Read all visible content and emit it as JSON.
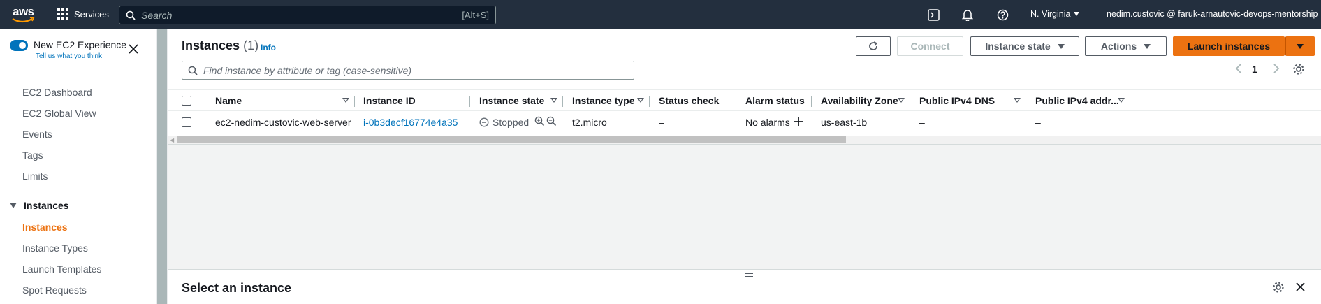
{
  "topnav": {
    "logo": "aws",
    "services_label": "Services",
    "search_placeholder": "Search",
    "search_shortcut": "[Alt+S]",
    "icons": [
      "cloudshell-icon",
      "bell-icon",
      "help-icon"
    ],
    "region": "N. Virginia",
    "account": "nedim.custovic @ faruk-arnautovic-devops-mentorship"
  },
  "sidebar": {
    "toggle_title": "New EC2 Experience",
    "toggle_sub": "Tell us what you think",
    "links_top": [
      "EC2 Dashboard",
      "EC2 Global View",
      "Events",
      "Tags",
      "Limits"
    ],
    "section": "Instances",
    "section_links": [
      "Instances",
      "Instance Types",
      "Launch Templates",
      "Spot Requests"
    ],
    "active": "Instances"
  },
  "main": {
    "title": "Instances",
    "count": "(1)",
    "info": "Info",
    "buttons": {
      "connect": "Connect",
      "instance_state": "Instance state",
      "actions": "Actions",
      "launch": "Launch instances"
    },
    "filter_placeholder": "Find instance by attribute or tag (case-sensitive)",
    "page": "1",
    "columns": [
      "Name",
      "Instance ID",
      "Instance state",
      "Instance type",
      "Status check",
      "Alarm status",
      "Availability Zone",
      "Public IPv4 DNS",
      "Public IPv4 addr..."
    ],
    "row": {
      "name": "ec2-nedim-custovic-web-server",
      "instance_id": "i-0b3decf16774e4a35",
      "state": "Stopped",
      "type": "t2.micro",
      "status_check": "–",
      "alarm": "No alarms",
      "az": "us-east-1b",
      "dns": "–",
      "ipv4": "–"
    },
    "details_title": "Select an instance"
  },
  "colors": {
    "nav_bg": "#232f3e",
    "accent_orange": "#ec7211",
    "link_blue": "#0073bb"
  }
}
